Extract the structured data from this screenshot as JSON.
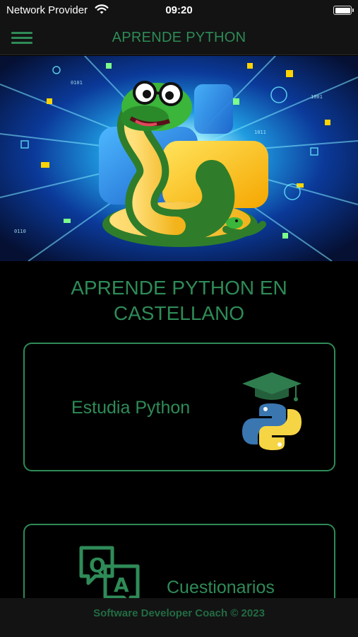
{
  "status_bar": {
    "carrier": "Network Provider",
    "time": "09:20"
  },
  "app_bar": {
    "title": "APRENDE PYTHON"
  },
  "headline": {
    "line1": "APRENDE PYTHON EN",
    "line2": "CASTELLANO"
  },
  "cards": {
    "study": {
      "label": "Estudia Python",
      "icon": "python-graduation-cap-icon"
    },
    "quiz": {
      "label": "Cuestionarios",
      "icon": "question-answer-icon"
    }
  },
  "footer": {
    "text": "Software Developer Coach © 2023"
  },
  "colors": {
    "accent": "#2e8b57",
    "background": "#000000",
    "bar": "#131313"
  }
}
